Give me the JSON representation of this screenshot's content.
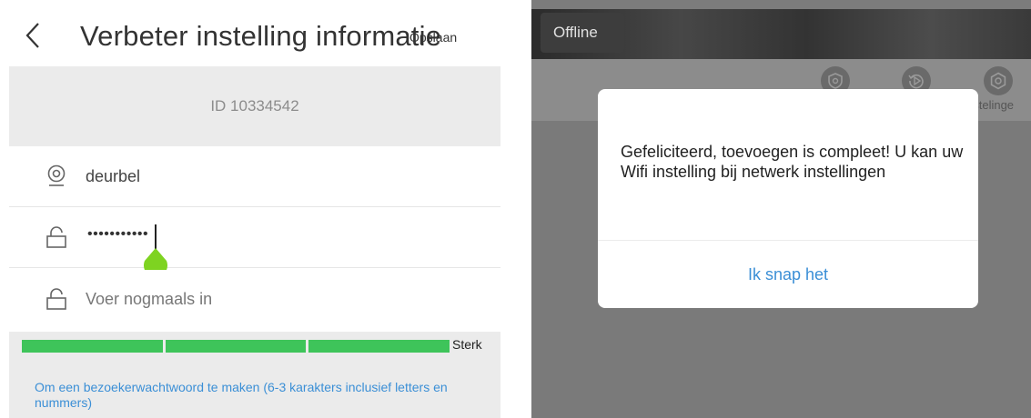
{
  "left_screen": {
    "header": {
      "title": "Verbeter instelling informatie",
      "save_label": "Opslaan",
      "back_icon": "chevron-left-icon"
    },
    "device_id": "ID 10334542",
    "fields": {
      "name": {
        "icon": "camera-icon",
        "value": "deurbel"
      },
      "password": {
        "icon": "lock-icon",
        "value": "•••••••••••"
      },
      "confirm": {
        "icon": "lock-icon",
        "placeholder": "Voer nogmaals in"
      }
    },
    "strength": {
      "label": "Sterk",
      "filled_segments": 3,
      "total_segments": 3,
      "color": "#3ec45a"
    },
    "hint": "Om een bezoekerwachtwoord te maken (6-3 karakters inclusief letters en nummers)",
    "colors": {
      "accent": "#3b8fd6",
      "cursor_handle": "#7ed321"
    }
  },
  "right_screen": {
    "status_badge": "Offline",
    "toolbar": {
      "icons": [
        "shield-icon",
        "playback-icon",
        "gear-icon"
      ],
      "partial_label": "nstelinge"
    },
    "dialog": {
      "message": "Gefeliciteerd, toevoegen is compleet! U kan uw Wifi instelling bij netwerk instellingen",
      "button_label": "Ik snap het"
    }
  }
}
